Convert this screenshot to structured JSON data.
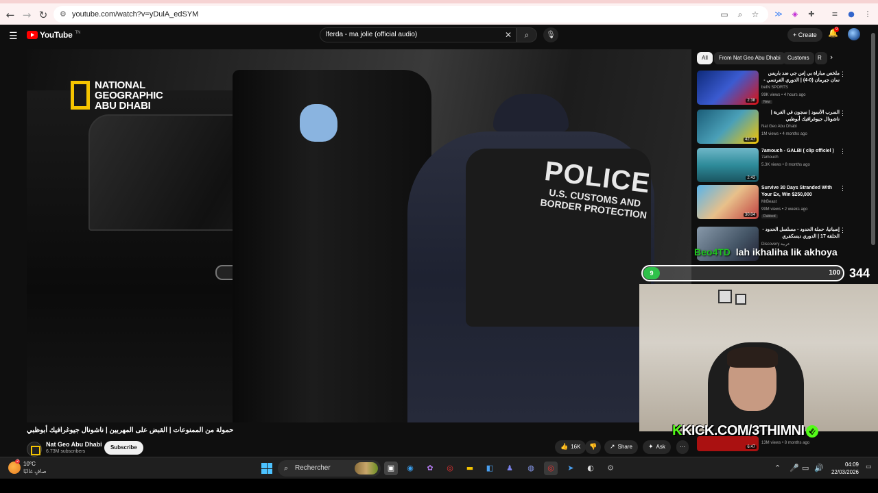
{
  "browser": {
    "url": "youtube.com/watch?v=yDulA_edSYM"
  },
  "youtube": {
    "logo_text": "YouTube",
    "logo_sup": "TN",
    "search_value": "lferda - ma jolie (official audio)",
    "create_label": "Create",
    "notif_count": "9"
  },
  "video": {
    "watermark_line1": "NATIONAL",
    "watermark_line2": "GEOGRAPHIC",
    "watermark_line3": "ABU DHABI",
    "vest_title": "POLICE",
    "vest_sub1": "U.S. CUSTOMS AND",
    "vest_sub2": "BORDER PROTECTION",
    "title": "حمولة من الممنوعات | القبض على المهربين | ناشونال جيوغرافيك أبوظبي",
    "channel": "Nat Geo Abu Dhabi",
    "subscribers": "6.73M subscribers",
    "subscribe_label": "Subscribe",
    "likes": "16K",
    "share_label": "Share",
    "ask_label": "Ask",
    "more": "⋯"
  },
  "sidebar": {
    "chips": [
      "All",
      "From Nat Geo Abu Dhabi",
      "Customs",
      "R"
    ],
    "recommendations": [
      {
        "title": "ملخص مباراة بي إس جي ضد باريس سان جيرمان (0-4) | الدوري الفرنسي - الجولة 27",
        "channel": "beIN SPORTS",
        "meta": "99K views • 4 hours ago",
        "badge": "New",
        "duration": "2:38",
        "thumb_color": "#1b3a8a"
      },
      {
        "title": "السرب الأسود | سجون في الغربة | ناشونال جيوغرافيك أبوظبي",
        "channel": "Nat Geo Abu Dhabi",
        "meta": "1M views • 4 months ago",
        "badge": "",
        "duration": "42:47",
        "thumb_color": "#2a6b8a"
      },
      {
        "title": "7amouch - GALBI ( clip officiel )",
        "channel": "7amouch",
        "meta": "5.3K views • 8 months ago",
        "badge": "",
        "duration": "2:43",
        "thumb_color": "#2e8b9a"
      },
      {
        "title": "Survive 30 Days Stranded With Your Ex, Win $250,000",
        "channel": "MrBeast",
        "meta": "99M views • 2 weeks ago",
        "badge": "Dubbed",
        "duration": "30:04",
        "thumb_color": "#3aa0d8"
      },
      {
        "title": "إسبانيا، حملة الحدود - مسلسل الحدود - الحلقة 17 | الدوري ديسكفري",
        "channel": "Discovery عربية",
        "meta": "",
        "badge": "",
        "duration": "",
        "thumb_color": "#556677"
      }
    ],
    "bottom_meta": "13M views • 8 months ago",
    "bottom_duration": "6:47"
  },
  "overlay": {
    "chat_user": "Beo4TD",
    "chat_message": "lah ikhaliha lik akhoya",
    "bar_left": "9",
    "bar_right": "100",
    "counter": "344",
    "kick_prefix": "K",
    "kick_text": "KICK.COM/3THIMNI"
  },
  "taskbar": {
    "weather_badge": "2",
    "temperature": "10°C",
    "weather_desc": "صافٍ غالبًا",
    "search_placeholder": "Rechercher",
    "time": "04:09",
    "date": "22/03/2026"
  }
}
